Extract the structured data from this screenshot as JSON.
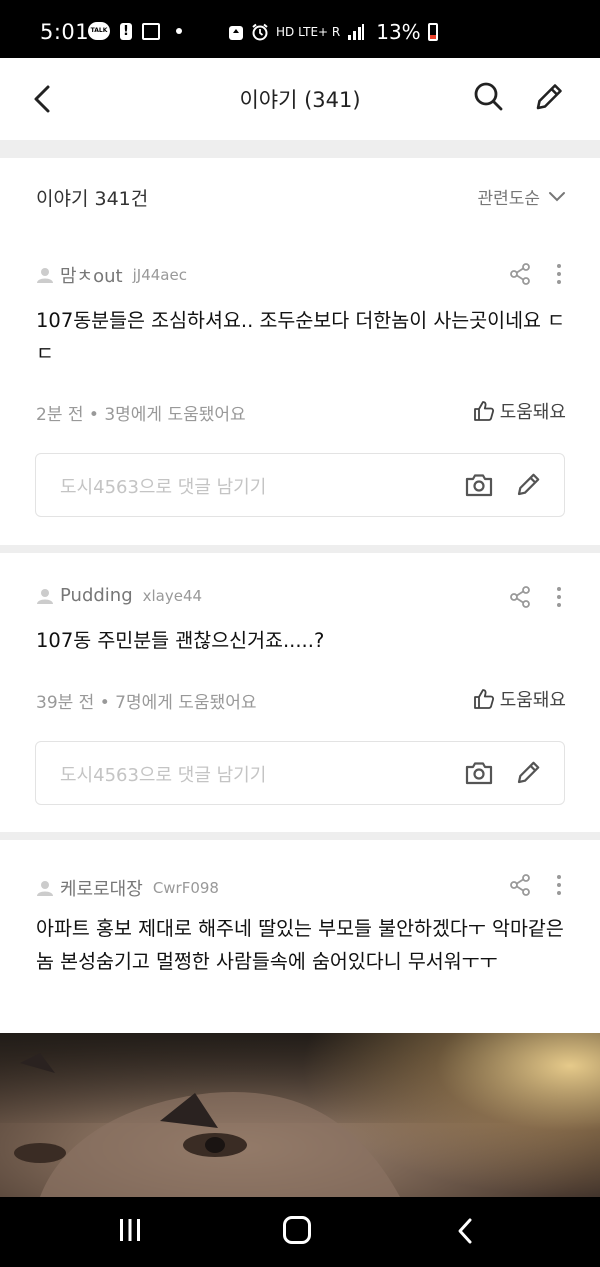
{
  "status_bar": {
    "time": "5:01",
    "talk_badge": "TALK",
    "excl_badge": "!",
    "network": "HD LTE+ R",
    "battery": "13%"
  },
  "header": {
    "title": "이야기 (341)",
    "back_icon": "chevron-left-icon",
    "search_icon": "search-icon",
    "edit_icon": "pencil-icon"
  },
  "list": {
    "count_label": "이야기 341건",
    "sort_label": "관련도순"
  },
  "posts": [
    {
      "author": "맘ㅊout",
      "author_id": "jJ44aec",
      "text": "107동분들은 조심하셔요.. 조두순보다 더한놈이 사는곳이네요 ㄷㄷ",
      "meta": "2분 전 • 3명에게 도움됐어요",
      "helpful_label": "도움돼요",
      "comment_placeholder": "도시4563으로 댓글 남기기"
    },
    {
      "author": "Pudding",
      "author_id": "xlaye44",
      "text": "107동 주민분들 괜찮으신거죠.....?",
      "meta": "39분 전 • 7명에게 도움됐어요",
      "helpful_label": "도움돼요",
      "comment_placeholder": "도시4563으로 댓글 남기기"
    },
    {
      "author": "케로로대장",
      "author_id": "CwrF098",
      "text": "아파트 홍보 제대로 해주네 딸있는 부모들 불안하겠다ㅜ 악마같은놈 본성숨기고 멀쩡한 사람들속에 숨어있다니 무서워ㅜㅜ"
    }
  ],
  "colors": {
    "background": "#ffffff",
    "separator": "#eeeeee",
    "muted_text": "#999999",
    "status_bar": "#000000"
  }
}
